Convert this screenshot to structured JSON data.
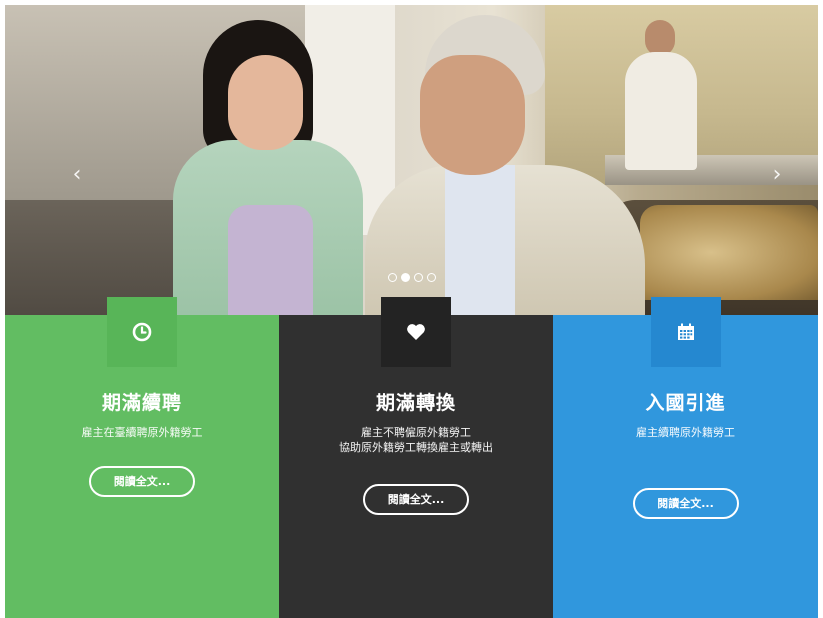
{
  "hero": {
    "prev_arrow": "‹",
    "next_arrow": "›",
    "slide_count": 4,
    "active_slide": 2
  },
  "panels": [
    {
      "icon": "clock-icon",
      "color": "#62bd62",
      "title": "期滿續聘",
      "desc_line1": "雇主在臺續聘原外籍勞工",
      "desc_line2": "",
      "button": "閱讀全文..."
    },
    {
      "icon": "heart-icon",
      "color": "#303030",
      "title": "期滿轉換",
      "desc_line1": "雇主不聘僱原外籍勞工",
      "desc_line2": "協助原外籍勞工轉換雇主或轉出",
      "button": "閱讀全文..."
    },
    {
      "icon": "calendar-icon",
      "color": "#3097dd",
      "title": "入國引進",
      "desc_line1": "雇主續聘原外籍勞工",
      "desc_line2": "",
      "button": "閱讀全文..."
    }
  ]
}
